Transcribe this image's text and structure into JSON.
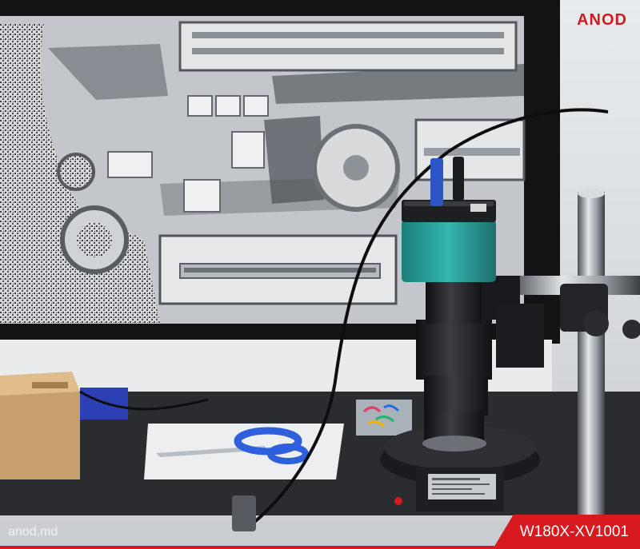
{
  "brand": {
    "logo_text": "ANOD",
    "color": "#d71920"
  },
  "footer": {
    "site": "anod.md",
    "model": "W180X-XV1001",
    "accent": "#d71920"
  },
  "objects": {
    "monitor_screen": "pcb-microscope-view",
    "camera": "teal-microscope-camera",
    "stand": "chrome-boom-stand",
    "tools": [
      "scissors",
      "box",
      "led-ring-light"
    ]
  }
}
